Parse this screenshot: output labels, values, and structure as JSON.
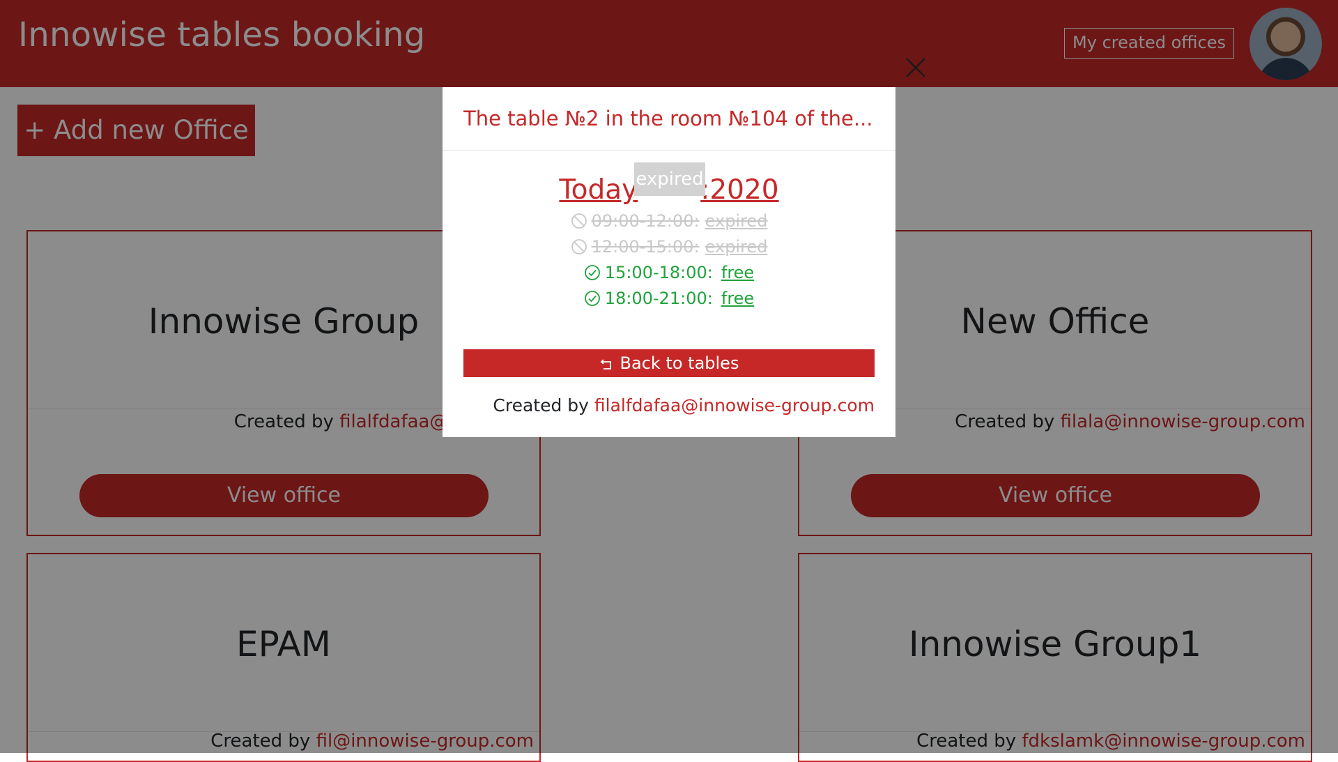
{
  "header": {
    "title": "Innowise tables booking",
    "my_offices_label": "My created offices"
  },
  "add_office_label": "+ Add new Office",
  "offices": [
    {
      "name": "Innowise Group",
      "created_by_label": "Created by",
      "email": "filalfdafaa@innowise-",
      "view_label": "View office"
    },
    {
      "name": "New Office",
      "created_by_label": "Created by",
      "email": "filala@innowise-group.com",
      "view_label": "View office"
    },
    {
      "name": "EPAM",
      "created_by_label": "Created by",
      "email": "fil@innowise-group.com"
    },
    {
      "name": "Innowise Group1",
      "created_by_label": "Created by",
      "email": "fdkslamk@innowise-group.com"
    }
  ],
  "modal": {
    "title": "The table №2 in the room №104 of the...",
    "date_prefix": "Today",
    "date_value": ":2020",
    "tooltip": "expired",
    "slots": [
      {
        "time": "09:00-12:00:",
        "status": "expired"
      },
      {
        "time": "12:00-15:00:",
        "status": "expired"
      },
      {
        "time": "15:00-18:00:",
        "status": "free"
      },
      {
        "time": "18:00-21:00:",
        "status": "free"
      }
    ],
    "back_label": "Back to tables",
    "created_by_label": "Created by",
    "created_by_email": "filalfdafaa@innowise-group.com"
  },
  "colors": {
    "brand": "#c62828",
    "free": "#1fa33b",
    "expired": "#c8c8c8"
  }
}
